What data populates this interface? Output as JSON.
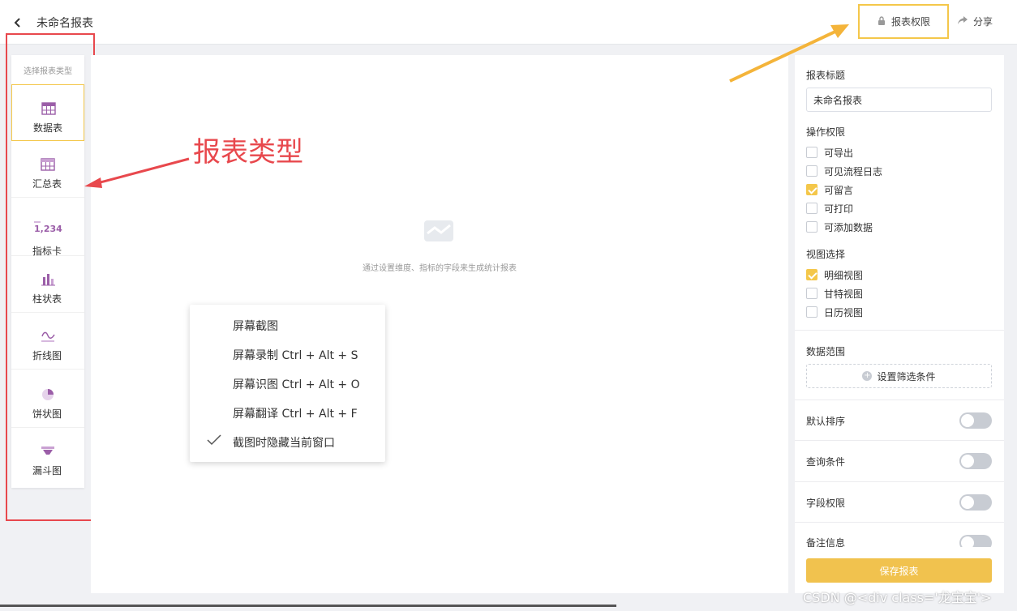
{
  "header": {
    "back_icon": "chevron-left-icon",
    "title": "未命名报表",
    "permission_label": "报表权限",
    "share_label": "分享"
  },
  "left_panel": {
    "label": "选择报表类型",
    "items": [
      {
        "label": "数据表",
        "icon": "table-icon",
        "active": true
      },
      {
        "label": "汇总表",
        "icon": "summary-table-icon",
        "active": false
      },
      {
        "label": "指标卡",
        "icon": "metric-card-icon",
        "icon_text": "1,234",
        "active": false
      },
      {
        "label": "柱状表",
        "icon": "bar-chart-icon",
        "active": false
      },
      {
        "label": "折线图",
        "icon": "line-chart-icon",
        "active": false
      },
      {
        "label": "饼状图",
        "icon": "pie-chart-icon",
        "active": false
      },
      {
        "label": "漏斗图",
        "icon": "funnel-chart-icon",
        "active": false
      }
    ]
  },
  "main": {
    "empty_hint": "通过设置维度、指标的字段来生成统计报表"
  },
  "annotation": {
    "text": "报表类型"
  },
  "context_menu": {
    "items": [
      {
        "label": "屏幕截图",
        "checked": false
      },
      {
        "label": "屏幕录制 Ctrl + Alt + S",
        "checked": false
      },
      {
        "label": "屏幕识图 Ctrl + Alt + O",
        "checked": false
      },
      {
        "label": "屏幕翻译 Ctrl + Alt + F",
        "checked": false
      },
      {
        "label": "截图时隐藏当前窗口",
        "checked": true
      }
    ]
  },
  "right_panel": {
    "report_title_label": "报表标题",
    "report_title_value": "未命名报表",
    "op_perm_label": "操作权限",
    "op_perms": [
      {
        "label": "可导出",
        "checked": false
      },
      {
        "label": "可见流程日志",
        "checked": false
      },
      {
        "label": "可留言",
        "checked": true
      },
      {
        "label": "可打印",
        "checked": false
      },
      {
        "label": "可添加数据",
        "checked": false
      }
    ],
    "view_label": "视图选择",
    "views": [
      {
        "label": "明细视图",
        "checked": true
      },
      {
        "label": "甘特视图",
        "checked": false
      },
      {
        "label": "日历视图",
        "checked": false
      }
    ],
    "data_range_label": "数据范围",
    "filter_button": "设置筛选条件",
    "toggles": [
      {
        "label": "默认排序",
        "on": false
      },
      {
        "label": "查询条件",
        "on": false
      },
      {
        "label": "字段权限",
        "on": false
      },
      {
        "label": "备注信息",
        "on": false
      }
    ],
    "save_button": "保存报表"
  },
  "watermark": "CSDN @<div class='龙宝宝'>",
  "colors": {
    "accent": "#f4c74a",
    "annotation_red": "#e8484d",
    "icon_purple": "#9b5ea8"
  }
}
